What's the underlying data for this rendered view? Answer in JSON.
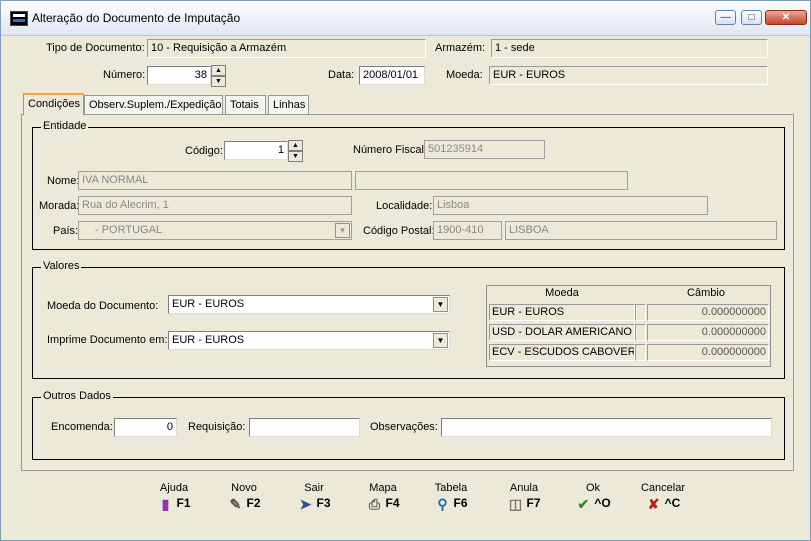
{
  "window": {
    "title": "Alteração do Documento de Imputação"
  },
  "header": {
    "tipo_label": "Tipo de Documento:",
    "tipo_value": "10 - Requisição a Armazém",
    "armazem_label": "Armazém:",
    "armazem_value": "1 - sede",
    "numero_label": "Número:",
    "numero_value": "38",
    "data_label": "Data:",
    "data_value": "2008/01/01",
    "moeda_label": "Moeda:",
    "moeda_value": "EUR - EUROS"
  },
  "tabs": [
    {
      "label": "Condições"
    },
    {
      "label": "Observ.Suplem./Expedição"
    },
    {
      "label": "Totais"
    },
    {
      "label": "Linhas"
    }
  ],
  "entidade": {
    "title": "Entidade",
    "codigo_label": "Código:",
    "codigo_value": "1",
    "nif_label": "Número Fiscal:",
    "nif_value": "501235914",
    "nome_label": "Nome:",
    "nome_value": "IVA NORMAL",
    "nome2_value": "",
    "morada_label": "Morada:",
    "morada_value": "Rua do Alecrim, 1",
    "localidade_label": "Localidade:",
    "localidade_value": "Lisboa",
    "pais_label": "País:",
    "pais_value": " - PORTUGAL",
    "cp_label": "Código Postal:",
    "cp_value": "1900-410",
    "cp_local_value": "LISBOA"
  },
  "valores": {
    "title": "Valores",
    "moeda_doc_label": "Moeda do Documento:",
    "moeda_doc_value": "EUR - EUROS",
    "imprime_label": "Imprime Documento em:",
    "imprime_value": "EUR - EUROS",
    "table_headers": {
      "moeda": "Moeda",
      "cambio": "Câmbio"
    },
    "rows": [
      {
        "moeda": "EUR - EUROS",
        "cambio": "0.000000000"
      },
      {
        "moeda": "USD - DOLAR AMERICANO",
        "cambio": "0.000000000"
      },
      {
        "moeda": "ECV - ESCUDOS CABOVERD",
        "cambio": "0.000000000"
      }
    ]
  },
  "outros": {
    "title": "Outros Dados",
    "encomenda_label": "Encomenda:",
    "encomenda_value": "0",
    "requisicao_label": "Requisição:",
    "requisicao_value": "",
    "observacoes_label": "Observações:",
    "observacoes_value": ""
  },
  "fkeys": [
    {
      "name": "Ajuda",
      "key": "F1",
      "icon": "book-icon"
    },
    {
      "name": "Novo",
      "key": "F2",
      "icon": "new-document-icon"
    },
    {
      "name": "Sair",
      "key": "F3",
      "icon": "exit-door-icon"
    },
    {
      "name": "Mapa",
      "key": "F4",
      "icon": "printer-icon"
    },
    {
      "name": "Tabela",
      "key": "F6",
      "icon": "table-search-icon"
    },
    {
      "name": "Anula",
      "key": "F7",
      "icon": "trash-icon"
    },
    {
      "name": "Ok",
      "key": "^O",
      "icon": "checkmark-icon"
    },
    {
      "name": "Cancelar",
      "key": "^C",
      "icon": "cancel-x-icon"
    }
  ],
  "colors": {
    "ok_green": "#2e8b2e",
    "cancel_red": "#b22222",
    "tab_accent": "#f6a23c"
  }
}
